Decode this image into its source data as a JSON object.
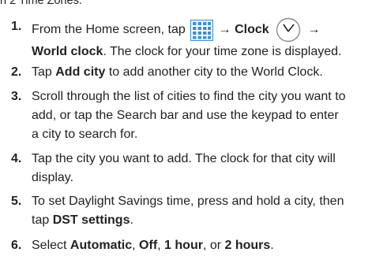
{
  "header": {
    "fragment": "n 2 Time Zones."
  },
  "steps": [
    {
      "number": "1.",
      "lines": [
        {
          "t1": "From the Home screen, tap ",
          "t2": " → Clock ",
          "t3": " →"
        },
        {
          "bold": "World clock",
          "rest": ". The clock for your time zone is displayed."
        }
      ]
    },
    {
      "number": "2.",
      "pre": "Tap ",
      "bold": "Add city",
      "post": " to add another city to the World Clock."
    },
    {
      "number": "3.",
      "lines": [
        "Scroll through the list of cities to find the city you want to",
        "add, or tap the Search bar and use the keypad to enter",
        "a city to search for."
      ]
    },
    {
      "number": "4.",
      "lines": [
        "Tap the city you want to add. The clock for that city will",
        "display."
      ]
    },
    {
      "number": "5.",
      "line1": "To set Daylight Savings time, press and hold a city, then",
      "pre2": "tap ",
      "bold2": "DST settings",
      "post2": "."
    },
    {
      "number": "6.",
      "pre": "Select ",
      "b1": "Automatic",
      "s1": ", ",
      "b2": "Off",
      "s2": ", ",
      "b3": "1 hour",
      "s3": ", or ",
      "b4": "2 hours",
      "post": "."
    }
  ],
  "icons": {
    "apps": "apps-grid-icon",
    "clock": "clock-icon",
    "accent": "#3b8fd8"
  }
}
